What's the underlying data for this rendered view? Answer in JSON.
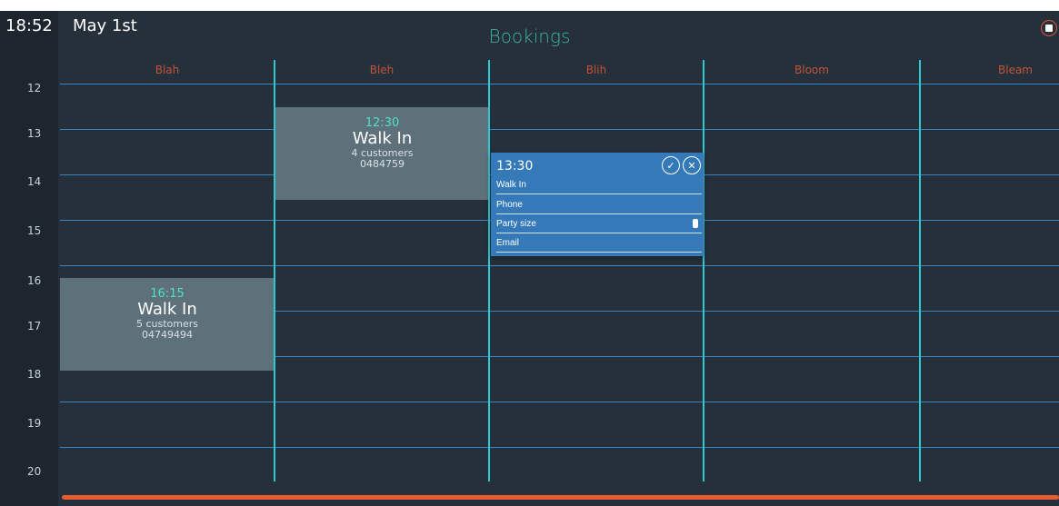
{
  "header": {
    "clock": "18:52",
    "date": "May 1st",
    "title": "Bookings",
    "settings_icon": "record-icon"
  },
  "columns": [
    "Blah",
    "Bleh",
    "Blih",
    "Bloom",
    "Bleam"
  ],
  "hours": [
    "12",
    "13",
    "14",
    "15",
    "16",
    "17",
    "18",
    "19",
    "20"
  ],
  "bookings": [
    {
      "column": "Bleh",
      "time": "12:30",
      "name": "Walk In",
      "customers": "4 customers",
      "phone": "0484759"
    },
    {
      "column": "Blah",
      "time": "16:15",
      "name": "Walk In",
      "customers": "5 customers",
      "phone": "04749494"
    }
  ],
  "editor": {
    "time": "13:30",
    "confirm_icon": "check-icon",
    "cancel_icon": "close-icon",
    "name_value": "Walk In",
    "phone_placeholder": "Phone",
    "party_size_placeholder": "Party size",
    "email_placeholder": "Email"
  },
  "colors": {
    "background": "#25303a",
    "gutter": "#1d262e",
    "title": "#3ab5a6",
    "column_label": "#c4533a",
    "grid_line": "#3a85c4",
    "column_divider": "#2ec7d6",
    "booking_block": "#5e707a",
    "booking_time": "#4ee0c8",
    "editor": "#3579b8",
    "accent_bar": "#e85a30"
  }
}
